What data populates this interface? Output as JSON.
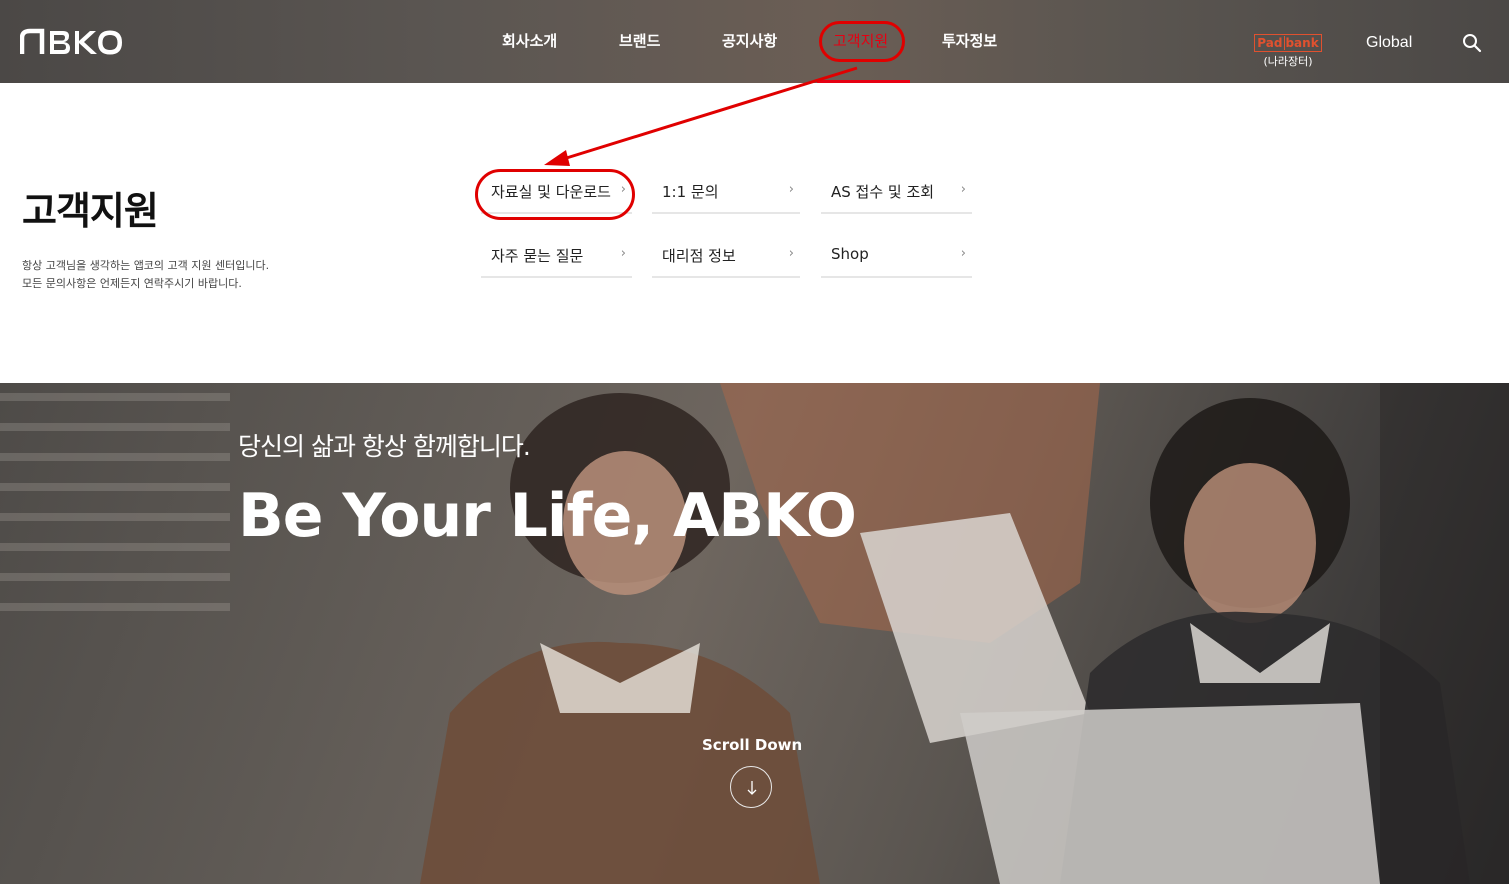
{
  "header": {
    "logo_text": "ABKO",
    "nav": [
      {
        "label": "회사소개"
      },
      {
        "label": "브랜드"
      },
      {
        "label": "공지사항"
      },
      {
        "label": "고객지원"
      },
      {
        "label": "투자정보"
      }
    ],
    "active_nav": "고객지원",
    "padbank": {
      "logo_pad": "Pad",
      "logo_bank": "bank",
      "sub": "(나라장터)"
    },
    "global_label": "Global",
    "search_icon": "search-icon"
  },
  "panel": {
    "title": "고객지원",
    "desc_line1": "항상 고객님을 생각하는 앱코의 고객 지원 센터입니다.",
    "desc_line2": "모든 문의사항은 언제든지 연락주시기 바랍니다.",
    "links": [
      {
        "label": "자료실 및 다운로드"
      },
      {
        "label": "1:1 문의"
      },
      {
        "label": "AS 접수 및 조회"
      },
      {
        "label": "자주 묻는 질문"
      },
      {
        "label": "대리점 정보"
      },
      {
        "label": "Shop"
      }
    ],
    "chevron_icon": "chevron-right-icon"
  },
  "hero": {
    "subtitle": "당신의 삶과 항상 함께합니다.",
    "title": "Be Your Life, ABKO",
    "scroll_label": "Scroll Down",
    "scroll_icon": "arrow-down-icon"
  },
  "colors": {
    "accent": "#e60012",
    "annotation": "#e00000",
    "padbank": "#e0512f"
  }
}
